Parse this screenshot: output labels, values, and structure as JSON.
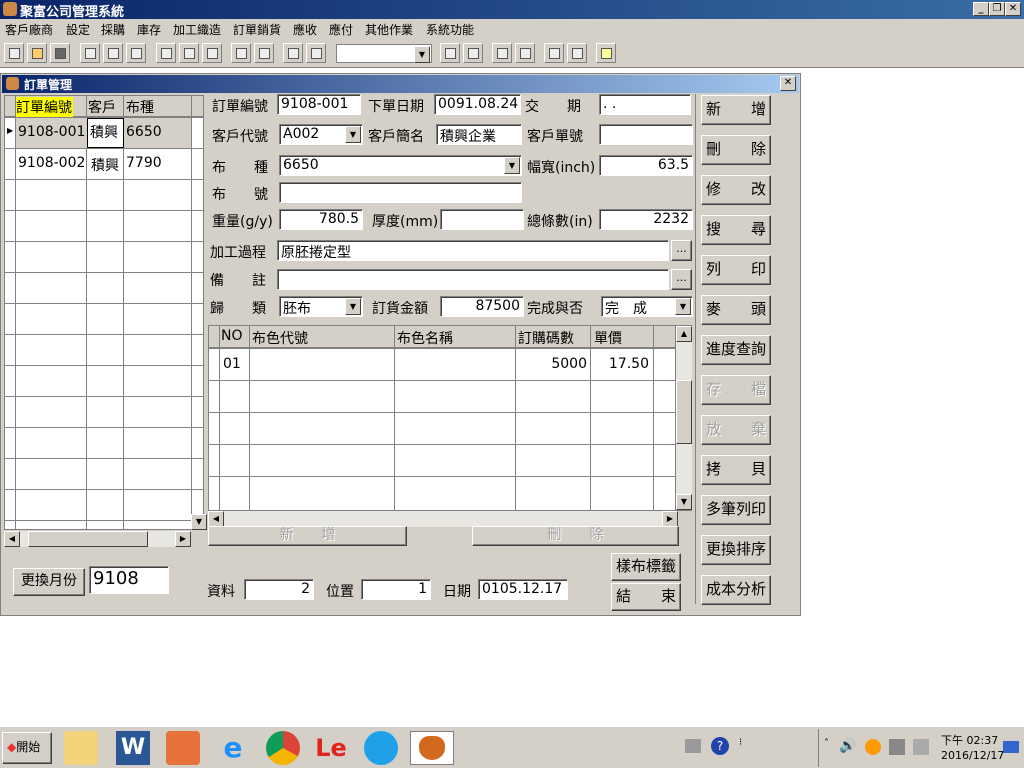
{
  "app": {
    "title": "聚富公司管理系統"
  },
  "menu": [
    "客戶廠商",
    "設定",
    "採購",
    "庫存",
    "加工織造",
    "訂單銷貨",
    "應收",
    "應付",
    "其他作業",
    "系統功能"
  ],
  "window": {
    "title": "訂單管理"
  },
  "list": {
    "headers": [
      "訂單編號",
      "客戶",
      "布種"
    ],
    "rows": [
      {
        "no": "9108-001",
        "cust": "積興",
        "kind": "6650"
      },
      {
        "no": "9108-002",
        "cust": "積興",
        "kind": "7790"
      }
    ]
  },
  "form": {
    "order_no_label": "訂單編號",
    "order_no": "9108-001",
    "order_date_label": "下單日期",
    "order_date": "0091.08.24",
    "delivery_label": "交　　期",
    "delivery": " .  .",
    "cust_code_label": "客戶代號",
    "cust_code": "A002",
    "cust_name_label": "客戶簡名",
    "cust_name": "積興企業",
    "cust_order_label": "客戶單號",
    "cust_order": "",
    "fabric_label": "布　　種",
    "fabric": "6650",
    "width_label": "幅寬(inch)",
    "width": "63.5",
    "cloth_no_label": "布　　號",
    "cloth_no": "",
    "weight_label": "重量(g/y)",
    "weight": "780.5",
    "thickness_label": "厚度(mm)",
    "thickness": "",
    "total_lines_label": "總條數(in)",
    "total_lines": "2232",
    "process_label": "加工過程",
    "process": "原胚捲定型",
    "remark_label": "備　　註",
    "remark": "",
    "category_label": "歸　　類",
    "category": "胚布",
    "amount_label": "訂貨金額",
    "amount": "87500",
    "done_label": "完成與否",
    "done": "完　成",
    "ellipsis": "..."
  },
  "detail": {
    "headers": [
      "NO",
      "布色代號",
      "布色名稱",
      "訂購碼數",
      "單價"
    ],
    "rows": [
      {
        "no": "01",
        "code": "",
        "name": "",
        "qty": "5000",
        "price": "17.50"
      }
    ],
    "add_label": "新　　增",
    "del_label": "刪　　除"
  },
  "buttons": [
    "新　　增",
    "刪　　除",
    "修　　改",
    "搜　　尋",
    "列　　印",
    "麥　　頭",
    "進度查詢",
    "存　　檔",
    "放　　棄",
    "拷　　貝",
    "多筆列印",
    "更換排序",
    "成本分析"
  ],
  "bottom": {
    "month_btn": "更換月份",
    "month": "9108",
    "records_label": "資料",
    "records": "2",
    "position_label": "位置",
    "position": "1",
    "date_label": "日期",
    "date": "0105.12.17",
    "label_btn": "樣布標籤",
    "end_btn": "結　　束"
  },
  "taskbar": {
    "start": "開始",
    "time": "下午 02:37",
    "date": "2016/12/17"
  },
  "colors": {
    "title": "#0a246a",
    "face": "#d4d0c8",
    "highlight": "#ffff00"
  }
}
